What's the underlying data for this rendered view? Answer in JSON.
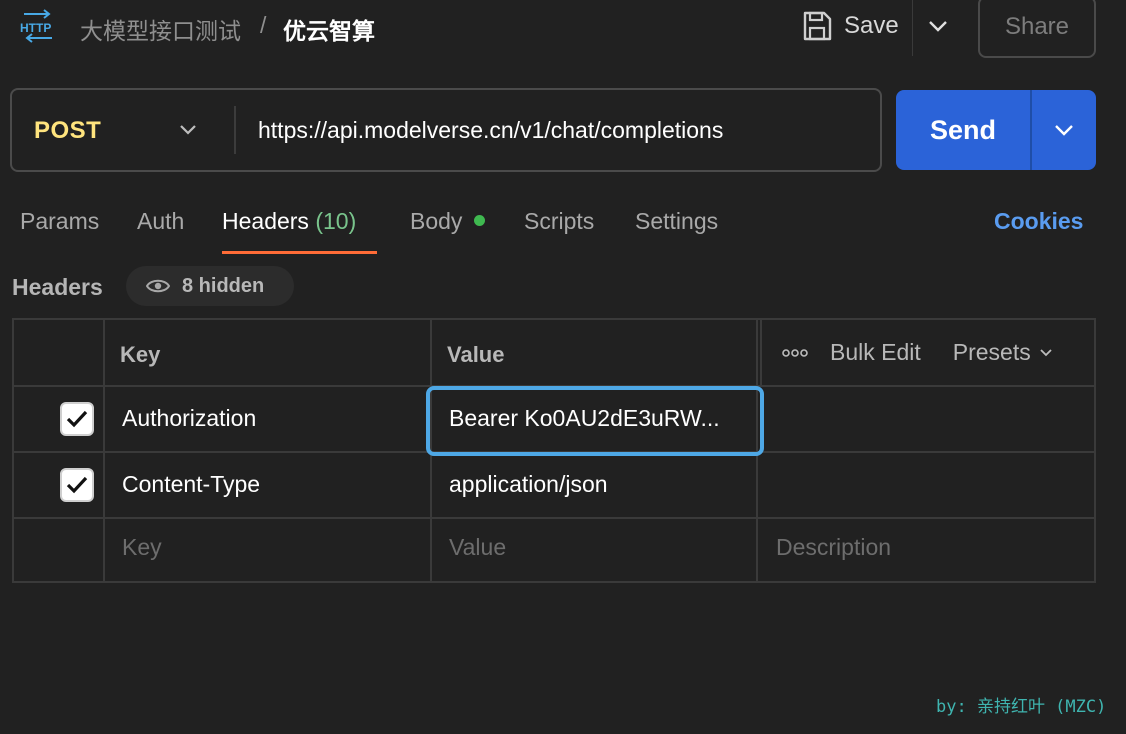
{
  "topbar": {
    "icon": "http-icon",
    "breadcrumb_parent": "大模型接口测试",
    "breadcrumb_separator": "/",
    "breadcrumb_current": "优云智算",
    "save_label": "Save",
    "share_label": "Share"
  },
  "request": {
    "method": "POST",
    "method_color": "#ffe47e",
    "url": "https://api.modelverse.cn/v1/chat/completions",
    "send_label": "Send",
    "send_color": "#2b63d8"
  },
  "tabs": {
    "items": [
      {
        "label": "Params"
      },
      {
        "label": "Auth"
      },
      {
        "label": "Headers",
        "count": "(10)"
      },
      {
        "label": "Body"
      },
      {
        "label": "Scripts"
      },
      {
        "label": "Settings"
      }
    ],
    "active": "Headers",
    "cookies_label": "Cookies",
    "accent_color": "#ff6c37"
  },
  "headers_section": {
    "title": "Headers",
    "hidden_label": "8 hidden",
    "columns": {
      "key": "Key",
      "value": "Value"
    },
    "bulk_edit_label": "Bulk Edit",
    "presets_label": "Presets",
    "rows": [
      {
        "checked": true,
        "key": "Authorization",
        "value": "Bearer Ko0AU2dE3uRW..."
      },
      {
        "checked": true,
        "key": "Content-Type",
        "value": "application/json"
      }
    ],
    "new_row": {
      "key_placeholder": "Key",
      "value_placeholder": "Value",
      "description_placeholder": "Description"
    }
  },
  "watermark": "by: 亲持红叶 (MZC)"
}
